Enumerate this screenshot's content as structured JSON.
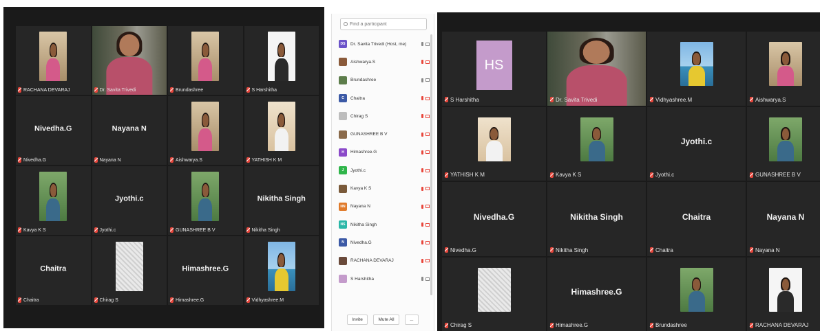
{
  "left_gallery": {
    "tiles": [
      {
        "name": "RACHANA DEVARAJ",
        "video": "photo-girl-indoor"
      },
      {
        "name": "Dr. Savita Trivedi",
        "video": "camera",
        "active": true
      },
      {
        "name": "Brundashree",
        "video": "photo-girl-indoor"
      },
      {
        "name": "S Harshitha",
        "video": "photo-girl-white"
      },
      {
        "name": "Nivedha.G",
        "display": "Nivedha.G"
      },
      {
        "name": "Nayana N",
        "display": "Nayana N"
      },
      {
        "name": "Aishwarya.S",
        "video": "photo-girl-indoor"
      },
      {
        "name": "YATHISH K M",
        "video": "photo-boy-white"
      },
      {
        "name": "Kavya K S",
        "video": "photo-girl-green"
      },
      {
        "name": "Jyothi.c",
        "display": "Jyothi.c"
      },
      {
        "name": "GUNASHREE B V",
        "video": "photo-girl-green"
      },
      {
        "name": "Nikitha Singh",
        "display": "Nikitha Singh"
      },
      {
        "name": "Chaitra",
        "display": "Chaitra"
      },
      {
        "name": "Chirag S",
        "video": "photo-sketch"
      },
      {
        "name": "Himashree.G",
        "display": "Himashree.G"
      },
      {
        "name": "Vidhyashree.M",
        "video": "photo-sky"
      }
    ]
  },
  "participants": {
    "search_placeholder": "Find a participant",
    "items": [
      {
        "initials": "DS",
        "name": "Dr. Savita Trivedi (Host, me)",
        "color": "#6b53c9",
        "muted": false
      },
      {
        "initials": "",
        "name": "Aishwarya.S",
        "color": "#8a5a3a",
        "muted": true
      },
      {
        "initials": "",
        "name": "Brundashree",
        "color": "#5d7d4b",
        "muted": false
      },
      {
        "initials": "C",
        "name": "Chaitra",
        "color": "#3c5aa6",
        "muted": true
      },
      {
        "initials": "",
        "name": "Chirag S",
        "color": "#bdbdbd",
        "muted": true
      },
      {
        "initials": "",
        "name": "GUNASHREE B V",
        "color": "#8a6a4a",
        "muted": true
      },
      {
        "initials": "H",
        "name": "Himashree.G",
        "color": "#8b4ac9",
        "muted": true
      },
      {
        "initials": "J",
        "name": "Jyothi.c",
        "color": "#2fb54a",
        "muted": true
      },
      {
        "initials": "",
        "name": "Kavya K S",
        "color": "#7a5a3a",
        "muted": true
      },
      {
        "initials": "NN",
        "name": "Nayana N",
        "color": "#e07a2a",
        "muted": true
      },
      {
        "initials": "NS",
        "name": "Nikitha Singh",
        "color": "#2bb7a8",
        "muted": true
      },
      {
        "initials": "N",
        "name": "Nivedha.G",
        "color": "#3c5aa6",
        "muted": true
      },
      {
        "initials": "",
        "name": "RACHANA DEVARAJ",
        "color": "#6a4a3a",
        "muted": true
      },
      {
        "initials": "",
        "name": "S Harshitha",
        "color": "#c49bcb",
        "muted": false
      }
    ],
    "invite_label": "Invite",
    "mute_all_label": "Mute All",
    "more_label": "..."
  },
  "right_gallery": {
    "tiles": [
      {
        "name": "S Harshitha",
        "avatar_initials": "HS",
        "avatar_color": "#c49bcb"
      },
      {
        "name": "Dr. Savita Trivedi",
        "video": "camera",
        "active": true
      },
      {
        "name": "Vidhyashree.M",
        "video": "photo-sky"
      },
      {
        "name": "Aishwarya.S",
        "video": "photo-girl-indoor"
      },
      {
        "name": "YATHISH K M",
        "video": "photo-boy-white"
      },
      {
        "name": "Kavya K S",
        "video": "photo-girl-green"
      },
      {
        "name": "Jyothi.c",
        "display": "Jyothi.c"
      },
      {
        "name": "GUNASHREE B V",
        "video": "photo-girl-green"
      },
      {
        "name": "Nivedha.G",
        "display": "Nivedha.G"
      },
      {
        "name": "Nikitha Singh",
        "display": "Nikitha Singh"
      },
      {
        "name": "Chaitra",
        "display": "Chaitra"
      },
      {
        "name": "Nayana N",
        "display": "Nayana N"
      },
      {
        "name": "Chirag S",
        "video": "photo-sketch"
      },
      {
        "name": "Himashree.G",
        "display": "Himashree.G"
      },
      {
        "name": "Brundashree",
        "video": "photo-girl-green"
      },
      {
        "name": "RACHANA DEVARAJ",
        "video": "photo-girl-white"
      }
    ]
  },
  "colors": {
    "gallery_bg": "#1a1a1a",
    "tile_bg": "#262626",
    "active_speaker": "#b8d86c",
    "muted_red": "#e8473c"
  }
}
